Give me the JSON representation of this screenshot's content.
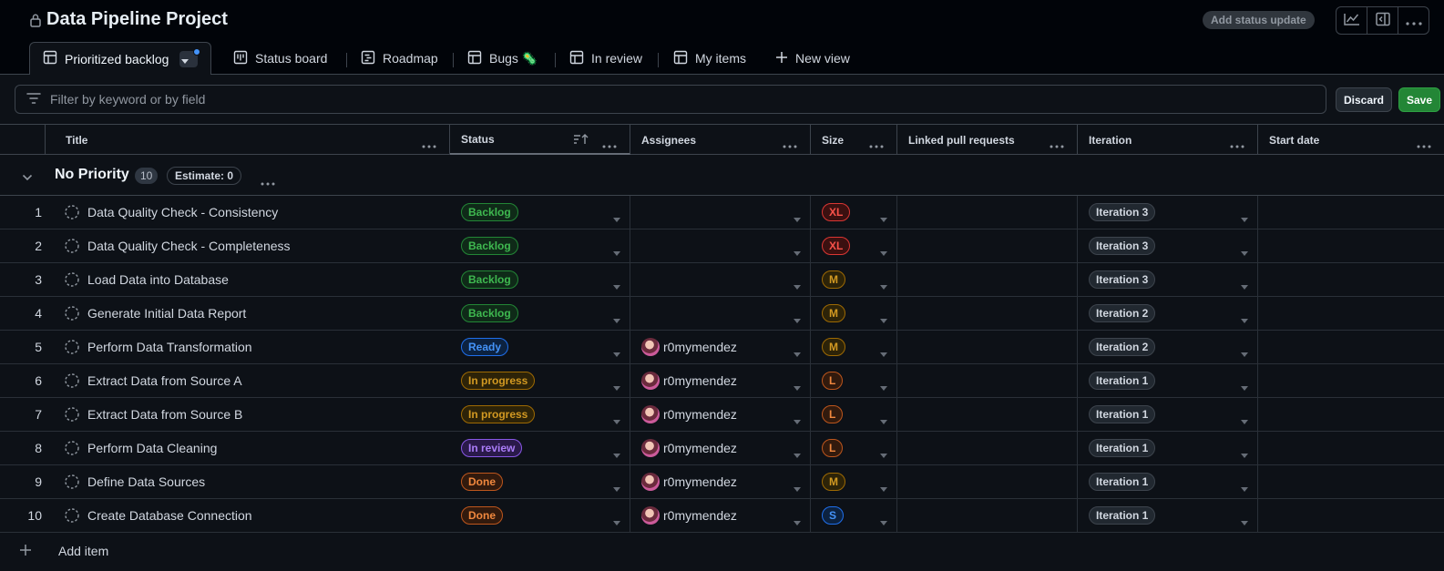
{
  "project": {
    "title": "Data Pipeline Project",
    "status_button": "Add status update"
  },
  "icons": {
    "lock": "lock-icon",
    "insights": "graph-icon",
    "side_panel": "sidebar-expand-icon",
    "menu": "kebab-horizontal-icon"
  },
  "tabs": [
    {
      "label": "Prioritized backlog",
      "icon": "table-icon",
      "active": true
    },
    {
      "label": "Status board",
      "icon": "board-icon"
    },
    {
      "label": "Roadmap",
      "icon": "roadmap-icon"
    },
    {
      "label": "Bugs 🦠",
      "icon": "table-icon"
    },
    {
      "label": "In review",
      "icon": "table-icon"
    },
    {
      "label": "My items",
      "icon": "table-icon"
    },
    {
      "label": "New view",
      "icon": "plus-icon"
    }
  ],
  "filter": {
    "placeholder": "Filter by keyword or by field",
    "discard": "Discard",
    "save": "Save"
  },
  "columns": [
    {
      "label": "Title"
    },
    {
      "label": "Status",
      "sorted": true
    },
    {
      "label": "Assignees"
    },
    {
      "label": "Size"
    },
    {
      "label": "Linked pull requests"
    },
    {
      "label": "Iteration"
    },
    {
      "label": "Start date"
    }
  ],
  "group": {
    "name": "No Priority",
    "count": "10",
    "estimate": "Estimate: 0"
  },
  "label_colors": {
    "Backlog": {
      "fg": "#3fb950",
      "bg": "#0f2a18",
      "border": "#238636"
    },
    "Ready": {
      "fg": "#4493f8",
      "bg": "#0c2240",
      "border": "#1f6feb"
    },
    "In progress": {
      "fg": "#d29922",
      "bg": "#2d2308",
      "border": "#9e6a03"
    },
    "In review": {
      "fg": "#ab7df8",
      "bg": "#2a1a4a",
      "border": "#8957e5"
    },
    "Done": {
      "fg": "#f0883e",
      "bg": "#321a0d",
      "border": "#bd561d"
    },
    "XL": {
      "fg": "#f85149",
      "bg": "#3b1010",
      "border": "#da3633"
    },
    "M": {
      "fg": "#d29922",
      "bg": "#2d2308",
      "border": "#9e6a03"
    },
    "L": {
      "fg": "#f0883e",
      "bg": "#321a0d",
      "border": "#bd561d"
    },
    "S": {
      "fg": "#4493f8",
      "bg": "#0c2240",
      "border": "#1f6feb"
    },
    "iteration": {
      "fg": "#d1d7e0",
      "bg": "#212830",
      "border": "#3d444d"
    }
  },
  "rows": [
    {
      "n": "1",
      "title": "Data Quality Check - Consistency",
      "status": "Backlog",
      "assignee": "",
      "size": "XL",
      "iteration": "Iteration 3"
    },
    {
      "n": "2",
      "title": "Data Quality Check - Completeness",
      "status": "Backlog",
      "assignee": "",
      "size": "XL",
      "iteration": "Iteration 3"
    },
    {
      "n": "3",
      "title": "Load Data into Database",
      "status": "Backlog",
      "assignee": "",
      "size": "M",
      "iteration": "Iteration 3"
    },
    {
      "n": "4",
      "title": "Generate Initial Data Report",
      "status": "Backlog",
      "assignee": "",
      "size": "M",
      "iteration": "Iteration 2"
    },
    {
      "n": "5",
      "title": "Perform Data Transformation",
      "status": "Ready",
      "assignee": "r0mymendez",
      "size": "M",
      "iteration": "Iteration 2"
    },
    {
      "n": "6",
      "title": "Extract Data from Source A",
      "status": "In progress",
      "assignee": "r0mymendez",
      "size": "L",
      "iteration": "Iteration 1"
    },
    {
      "n": "7",
      "title": "Extract Data from Source B",
      "status": "In progress",
      "assignee": "r0mymendez",
      "size": "L",
      "iteration": "Iteration 1"
    },
    {
      "n": "8",
      "title": "Perform Data Cleaning",
      "status": "In review",
      "assignee": "r0mymendez",
      "size": "L",
      "iteration": "Iteration 1"
    },
    {
      "n": "9",
      "title": "Define Data Sources",
      "status": "Done",
      "assignee": "r0mymendez",
      "size": "M",
      "iteration": "Iteration 1"
    },
    {
      "n": "10",
      "title": "Create Database Connection",
      "status": "Done",
      "assignee": "r0mymendez",
      "size": "S",
      "iteration": "Iteration 1"
    }
  ],
  "add_item": "Add item"
}
